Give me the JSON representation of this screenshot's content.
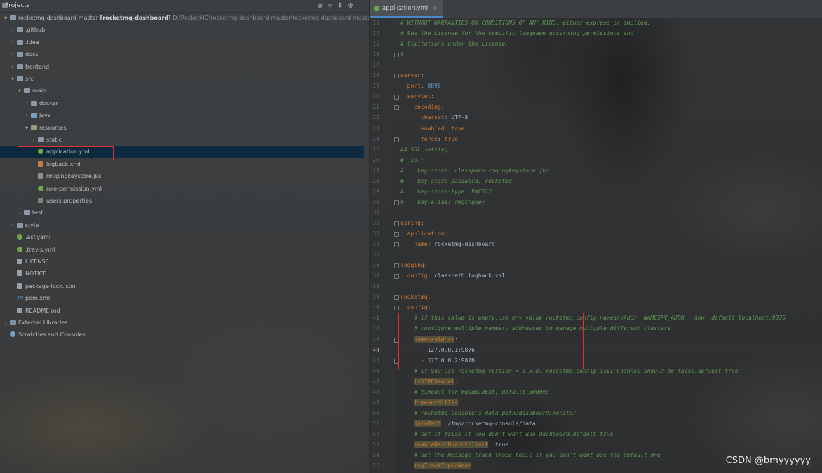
{
  "project_panel": {
    "title": "Project",
    "chevron": "▾",
    "header_icons": [
      "globe-icon",
      "expand-icon",
      "collapse-icon",
      "gear-icon",
      "minimize-icon"
    ],
    "tree": [
      {
        "indent": 0,
        "arrow": "▾",
        "icon": "folder",
        "label": "rocketmq-dashboard-master",
        "bold": "[rocketmq-dashboard]",
        "path": "D:\\RocketMQ\\rocketmq-dashboard-master\\rocketmq-dashboard-master"
      },
      {
        "indent": 1,
        "arrow": "›",
        "icon": "folder",
        "label": ".github"
      },
      {
        "indent": 1,
        "arrow": "›",
        "icon": "folder",
        "label": ".idea"
      },
      {
        "indent": 1,
        "arrow": "›",
        "icon": "folder",
        "label": "docs"
      },
      {
        "indent": 1,
        "arrow": "›",
        "icon": "folder",
        "label": "frontend"
      },
      {
        "indent": 1,
        "arrow": "▾",
        "icon": "folder",
        "label": "src"
      },
      {
        "indent": 2,
        "arrow": "▾",
        "icon": "folder",
        "label": "main"
      },
      {
        "indent": 3,
        "arrow": "›",
        "icon": "folder",
        "label": "docker"
      },
      {
        "indent": 3,
        "arrow": "›",
        "icon": "folder-src",
        "label": "java"
      },
      {
        "indent": 3,
        "arrow": "▾",
        "icon": "folder-res",
        "label": "resources"
      },
      {
        "indent": 4,
        "arrow": "›",
        "icon": "folder",
        "label": "static"
      },
      {
        "indent": 4,
        "arrow": "",
        "icon": "yml",
        "label": "application.yml",
        "selected": true
      },
      {
        "indent": 4,
        "arrow": "",
        "icon": "xml",
        "label": "logback.xml"
      },
      {
        "indent": 4,
        "arrow": "",
        "icon": "jks",
        "label": "rmqcngkeystore.jks"
      },
      {
        "indent": 4,
        "arrow": "",
        "icon": "yml",
        "label": "role-permission.yml"
      },
      {
        "indent": 4,
        "arrow": "",
        "icon": "props",
        "label": "users.properties"
      },
      {
        "indent": 2,
        "arrow": "›",
        "icon": "folder",
        "label": "test"
      },
      {
        "indent": 1,
        "arrow": "›",
        "icon": "folder",
        "label": "style"
      },
      {
        "indent": 1,
        "arrow": "",
        "icon": "yml",
        "label": ".asf.yaml"
      },
      {
        "indent": 1,
        "arrow": "",
        "icon": "yml",
        "label": ".travis.yml"
      },
      {
        "indent": 1,
        "arrow": "",
        "icon": "file",
        "label": "LICENSE"
      },
      {
        "indent": 1,
        "arrow": "",
        "icon": "file",
        "label": "NOTICE"
      },
      {
        "indent": 1,
        "arrow": "",
        "icon": "file",
        "label": "package-lock.json"
      },
      {
        "indent": 1,
        "arrow": "",
        "icon": "m",
        "label": "pom.xml"
      },
      {
        "indent": 1,
        "arrow": "",
        "icon": "file",
        "label": "README.md"
      },
      {
        "indent": 0,
        "arrow": "›",
        "icon": "lib",
        "label": "External Libraries"
      },
      {
        "indent": 0,
        "arrow": "",
        "icon": "scratch",
        "label": "Scratches and Consoles"
      }
    ]
  },
  "editor": {
    "tab": {
      "label": "application.yml",
      "close": "×"
    },
    "current_line": 44,
    "lines": [
      {
        "n": 13,
        "fold": false,
        "segs": [
          [
            "c-com",
            "# WITHOUT WARRANTIES OR CONDITIONS OF ANY KIND, either express or implied."
          ]
        ]
      },
      {
        "n": 14,
        "fold": false,
        "segs": [
          [
            "c-com",
            "# See the License for the specific language governing permissions and"
          ]
        ]
      },
      {
        "n": 15,
        "fold": false,
        "segs": [
          [
            "c-com",
            "# limitations under the License."
          ]
        ]
      },
      {
        "n": 16,
        "fold": true,
        "segs": [
          [
            "c-com",
            "#"
          ]
        ]
      },
      {
        "n": 17,
        "fold": false,
        "segs": []
      },
      {
        "n": 18,
        "fold": true,
        "segs": [
          [
            "c-key",
            "server"
          ],
          [
            "c-plain",
            ":"
          ]
        ]
      },
      {
        "n": 19,
        "fold": false,
        "segs": [
          [
            "c-plain",
            "  "
          ],
          [
            "c-key",
            "port"
          ],
          [
            "c-plain",
            ": "
          ],
          [
            "c-num",
            "8899"
          ]
        ]
      },
      {
        "n": 20,
        "fold": true,
        "segs": [
          [
            "c-plain",
            "  "
          ],
          [
            "c-key",
            "servlet"
          ],
          [
            "c-plain",
            ":"
          ]
        ]
      },
      {
        "n": 21,
        "fold": true,
        "segs": [
          [
            "c-plain",
            "    "
          ],
          [
            "c-key",
            "encoding"
          ],
          [
            "c-plain",
            ":"
          ]
        ]
      },
      {
        "n": 22,
        "fold": false,
        "segs": [
          [
            "c-plain",
            "      "
          ],
          [
            "c-key",
            "charset"
          ],
          [
            "c-plain",
            ": UTF-8"
          ]
        ]
      },
      {
        "n": 23,
        "fold": false,
        "segs": [
          [
            "c-plain",
            "      "
          ],
          [
            "c-key",
            "enabled"
          ],
          [
            "c-plain",
            ": "
          ],
          [
            "c-key",
            "true"
          ]
        ]
      },
      {
        "n": 24,
        "fold": true,
        "segs": [
          [
            "c-plain",
            "      "
          ],
          [
            "c-key",
            "force"
          ],
          [
            "c-plain",
            ": "
          ],
          [
            "c-key",
            "true"
          ]
        ]
      },
      {
        "n": 25,
        "fold": false,
        "segs": [
          [
            "c-com",
            "## SSL setting"
          ]
        ]
      },
      {
        "n": 26,
        "fold": false,
        "segs": [
          [
            "c-com",
            "#  ssl:"
          ]
        ]
      },
      {
        "n": 27,
        "fold": false,
        "segs": [
          [
            "c-com",
            "#    key-store: classpath:rmqcngkeystore.jks"
          ]
        ]
      },
      {
        "n": 28,
        "fold": false,
        "segs": [
          [
            "c-com",
            "#    key-store-password: rocketmq"
          ]
        ]
      },
      {
        "n": 29,
        "fold": false,
        "segs": [
          [
            "c-com",
            "#    key-store-type: PKCS12"
          ]
        ]
      },
      {
        "n": 30,
        "fold": true,
        "segs": [
          [
            "c-com",
            "#    key-alias: rmqcngkey"
          ]
        ]
      },
      {
        "n": 31,
        "fold": false,
        "segs": []
      },
      {
        "n": 32,
        "fold": true,
        "segs": [
          [
            "c-key",
            "spring"
          ],
          [
            "c-plain",
            ":"
          ]
        ]
      },
      {
        "n": 33,
        "fold": true,
        "segs": [
          [
            "c-plain",
            "  "
          ],
          [
            "c-key",
            "application"
          ],
          [
            "c-plain",
            ":"
          ]
        ]
      },
      {
        "n": 34,
        "fold": true,
        "segs": [
          [
            "c-plain",
            "    "
          ],
          [
            "c-key",
            "name"
          ],
          [
            "c-plain",
            ": rocketmq-dashboard"
          ]
        ]
      },
      {
        "n": 35,
        "fold": false,
        "segs": []
      },
      {
        "n": 36,
        "fold": true,
        "segs": [
          [
            "c-key",
            "logging"
          ],
          [
            "c-plain",
            ":"
          ]
        ]
      },
      {
        "n": 37,
        "fold": true,
        "segs": [
          [
            "c-plain",
            "  "
          ],
          [
            "c-key",
            "config"
          ],
          [
            "c-plain",
            ": classpath:logback.xml"
          ]
        ]
      },
      {
        "n": 38,
        "fold": false,
        "segs": []
      },
      {
        "n": 39,
        "fold": true,
        "segs": [
          [
            "c-key",
            "rocketmq"
          ],
          [
            "c-plain",
            ":"
          ]
        ]
      },
      {
        "n": 40,
        "fold": true,
        "segs": [
          [
            "c-plain",
            "  "
          ],
          [
            "c-key",
            "config"
          ],
          [
            "c-plain",
            ":"
          ]
        ]
      },
      {
        "n": 41,
        "fold": false,
        "segs": [
          [
            "c-plain",
            "    "
          ],
          [
            "c-com",
            "# if this value is empty,use env value rocketmq.config.namesrvAddr  NAMESRV_ADDR | now, default localhost:9876"
          ]
        ]
      },
      {
        "n": 42,
        "fold": false,
        "segs": [
          [
            "c-plain",
            "    "
          ],
          [
            "c-com",
            "# configure multiple namesrv addresses to manage multiple different clusters"
          ]
        ]
      },
      {
        "n": 43,
        "fold": true,
        "segs": [
          [
            "c-plain",
            "    "
          ],
          [
            "c-hl",
            "namesrvAddrs"
          ],
          [
            "c-plain",
            ":"
          ]
        ]
      },
      {
        "n": 44,
        "fold": false,
        "segs": [
          [
            "c-plain",
            "      - 127.0.0.1:9876"
          ]
        ]
      },
      {
        "n": 45,
        "fold": true,
        "segs": [
          [
            "c-plain",
            "      - 127.0.0.2:9876"
          ]
        ]
      },
      {
        "n": 46,
        "fold": false,
        "segs": [
          [
            "c-plain",
            "    "
          ],
          [
            "c-com",
            "# if you use rocketmq version < 3.5.8, rocketmq.config.isVIPChannel should be false.default true"
          ]
        ]
      },
      {
        "n": 47,
        "fold": false,
        "segs": [
          [
            "c-plain",
            "    "
          ],
          [
            "c-hl",
            "isVIPChannel"
          ],
          [
            "c-plain",
            ":"
          ]
        ]
      },
      {
        "n": 48,
        "fold": false,
        "segs": [
          [
            "c-plain",
            "    "
          ],
          [
            "c-com",
            "# timeout for mqadminExt, default 5000ms"
          ]
        ]
      },
      {
        "n": 49,
        "fold": false,
        "segs": [
          [
            "c-plain",
            "    "
          ],
          [
            "c-hl",
            "timeoutMillis"
          ],
          [
            "c-plain",
            ":"
          ]
        ]
      },
      {
        "n": 50,
        "fold": false,
        "segs": [
          [
            "c-plain",
            "    "
          ],
          [
            "c-com",
            "# rocketmq-console's data path:dashboard/monitor"
          ]
        ]
      },
      {
        "n": 51,
        "fold": false,
        "segs": [
          [
            "c-plain",
            "    "
          ],
          [
            "c-hl",
            "dataPath"
          ],
          [
            "c-plain",
            ": /tmp/rocketmq-console/data"
          ]
        ]
      },
      {
        "n": 52,
        "fold": false,
        "segs": [
          [
            "c-plain",
            "    "
          ],
          [
            "c-com",
            "# set it false if you don't want use dashboard.default true"
          ]
        ]
      },
      {
        "n": 53,
        "fold": false,
        "segs": [
          [
            "c-plain",
            "    "
          ],
          [
            "c-hl",
            "enableDashBoardCollect"
          ],
          [
            "c-plain",
            ": true"
          ]
        ]
      },
      {
        "n": 54,
        "fold": false,
        "segs": [
          [
            "c-plain",
            "    "
          ],
          [
            "c-com",
            "# set the message track trace topic if you don't want use the default one"
          ]
        ]
      },
      {
        "n": 55,
        "fold": false,
        "segs": [
          [
            "c-plain",
            "    "
          ],
          [
            "c-hl",
            "msgTrackTopicName"
          ],
          [
            "c-plain",
            ":"
          ]
        ]
      }
    ]
  },
  "watermark": "CSDN @bmyyyyyy",
  "colors": {
    "highlight_box": "#e02f33",
    "selection": "#0d293e"
  }
}
